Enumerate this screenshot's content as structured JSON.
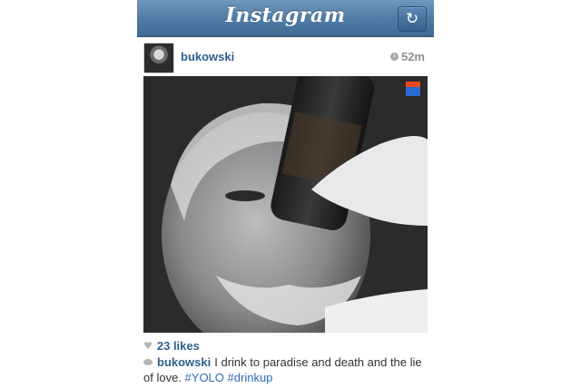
{
  "header": {
    "title": "Instagram",
    "refresh_icon": "refresh-icon"
  },
  "post": {
    "username": "bukowski",
    "time": "52m",
    "likes": "23 likes",
    "caption": {
      "username": "bukowski",
      "text": "I drink to paradise and death and the lie of love.",
      "hashtags": [
        "#YOLO",
        "#drinkup"
      ]
    }
  },
  "colors": {
    "topbar": "#4f7aa3",
    "link": "#2f5f8c",
    "hashtag": "#2f6cb5"
  }
}
